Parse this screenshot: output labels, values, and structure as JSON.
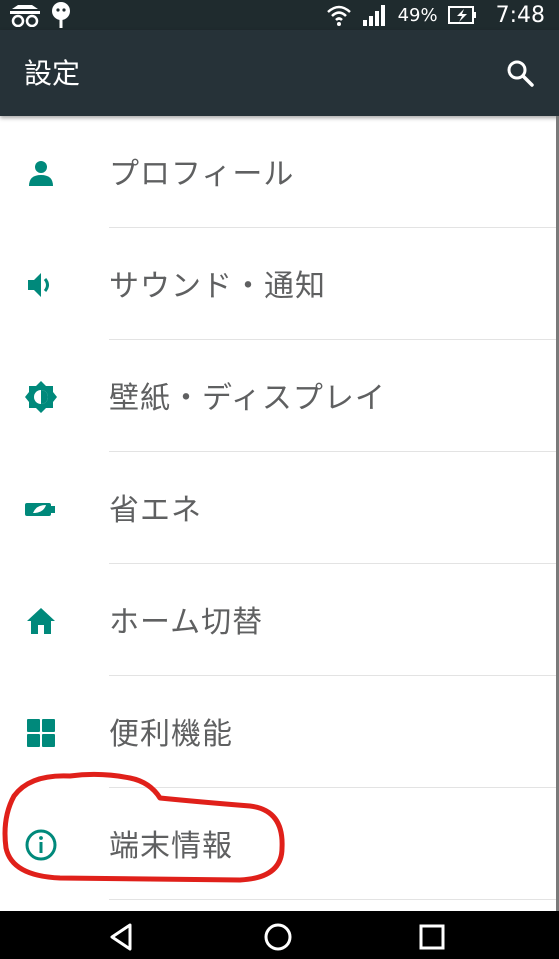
{
  "status_bar": {
    "battery_percent": "49%",
    "time": "7:48",
    "icons": [
      "cat-icon",
      "android-icon",
      "wifi-icon",
      "signal-icon",
      "battery-charging-icon"
    ]
  },
  "app_bar": {
    "title": "設定",
    "search_icon": "search-icon"
  },
  "settings": {
    "items": [
      {
        "label": "プロフィール",
        "icon": "person-icon"
      },
      {
        "label": "サウンド・通知",
        "icon": "volume-icon"
      },
      {
        "label": "壁紙・ディスプレイ",
        "icon": "brightness-icon"
      },
      {
        "label": "省エネ",
        "icon": "battery-leaf-icon"
      },
      {
        "label": "ホーム切替",
        "icon": "home-icon"
      },
      {
        "label": "便利機能",
        "icon": "grid-icon"
      },
      {
        "label": "端末情報",
        "icon": "info-icon"
      }
    ]
  },
  "nav_bar": {
    "buttons": [
      "back-icon",
      "home-circle-icon",
      "recents-icon"
    ]
  },
  "colors": {
    "accent": "#00897b",
    "app_bar": "#263238",
    "status_bar": "#1f2b2e",
    "annotation": "#e0201a",
    "label_text": "#5f6061"
  }
}
